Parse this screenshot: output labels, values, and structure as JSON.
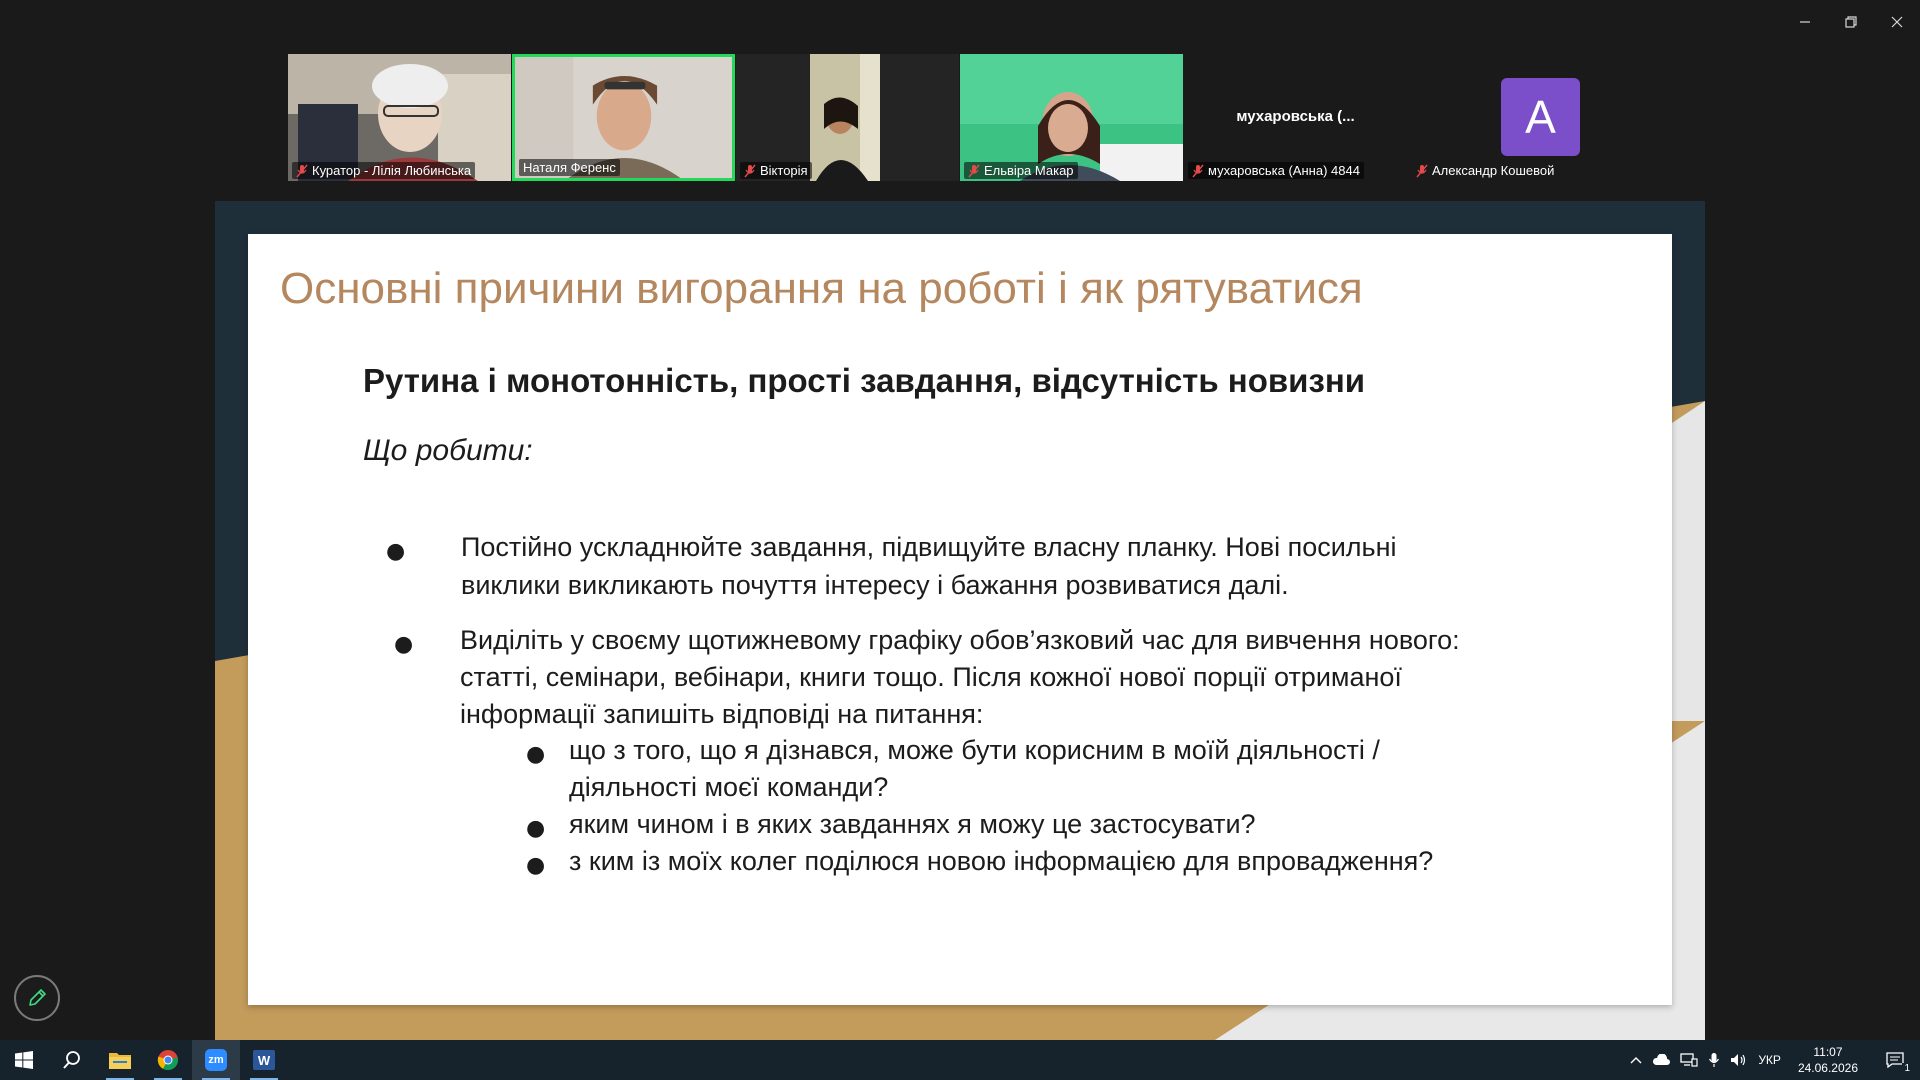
{
  "participants": [
    {
      "name": "Куратор - Лілія Любинська",
      "muted": true,
      "active": false
    },
    {
      "name": "Наталя Ференс",
      "muted": false,
      "active": true
    },
    {
      "name": "Вікторія",
      "muted": true,
      "active": false
    },
    {
      "name": "Ельвіра Макар",
      "muted": true,
      "active": false
    },
    {
      "name": "мухаровська  (Анна) 4844",
      "muted": true,
      "active": false,
      "center_label": "мухаровська   (..."
    },
    {
      "name": "Александр Кошевой",
      "muted": true,
      "active": false,
      "avatar_letter": "A"
    }
  ],
  "slide": {
    "title": "Основні причини вигорання на роботі і як рятуватися",
    "subtitle": "Рутина і монотонність, прості завдання, відсутність новизни",
    "what_to_do": "Що робити:",
    "bullet_char": "●",
    "bullets": [
      {
        "lines": [
          "Постійно ускладнюйте завдання, підвищуйте власну планку. Нові посильні",
          "виклики викликають почуття інтересу і бажання розвиватися далі."
        ]
      },
      {
        "lines": [
          "Виділіть у своєму щотижневому графіку обов’язковий час для вивчення нового:",
          "статті, семінари, вебінари, книги тощо. Після кожної нової порції отриманої",
          "інформації запишіть відповіді на питання:"
        ]
      }
    ],
    "sub_bullets": [
      {
        "lines": [
          "що з того, що я дізнався, може бути корисним в моїй діяльності /",
          "діяльності моєї команди?"
        ]
      },
      {
        "lines": [
          "яким чином і в яких завданнях я можу це застосувати?"
        ]
      },
      {
        "lines": [
          "з ким із моїх колег поділюся новою інформацією для впровадження?"
        ]
      }
    ]
  },
  "taskbar": {
    "apps": [
      "start-icon",
      "search-icon",
      "file-explorer-icon",
      "chrome-icon",
      "zoom-icon",
      "word-icon"
    ],
    "zoom_label": "zm",
    "word_label": "W",
    "language": "УКР",
    "time": "11:07",
    "date": "24.06.2026",
    "notifications_count": "1"
  },
  "colors": {
    "title": "#b4875f",
    "active_border": "#23d959",
    "avatar": "#7b4fc9",
    "slide_frame": "#1f2f3a",
    "slide_gold": "#c39b5b"
  }
}
